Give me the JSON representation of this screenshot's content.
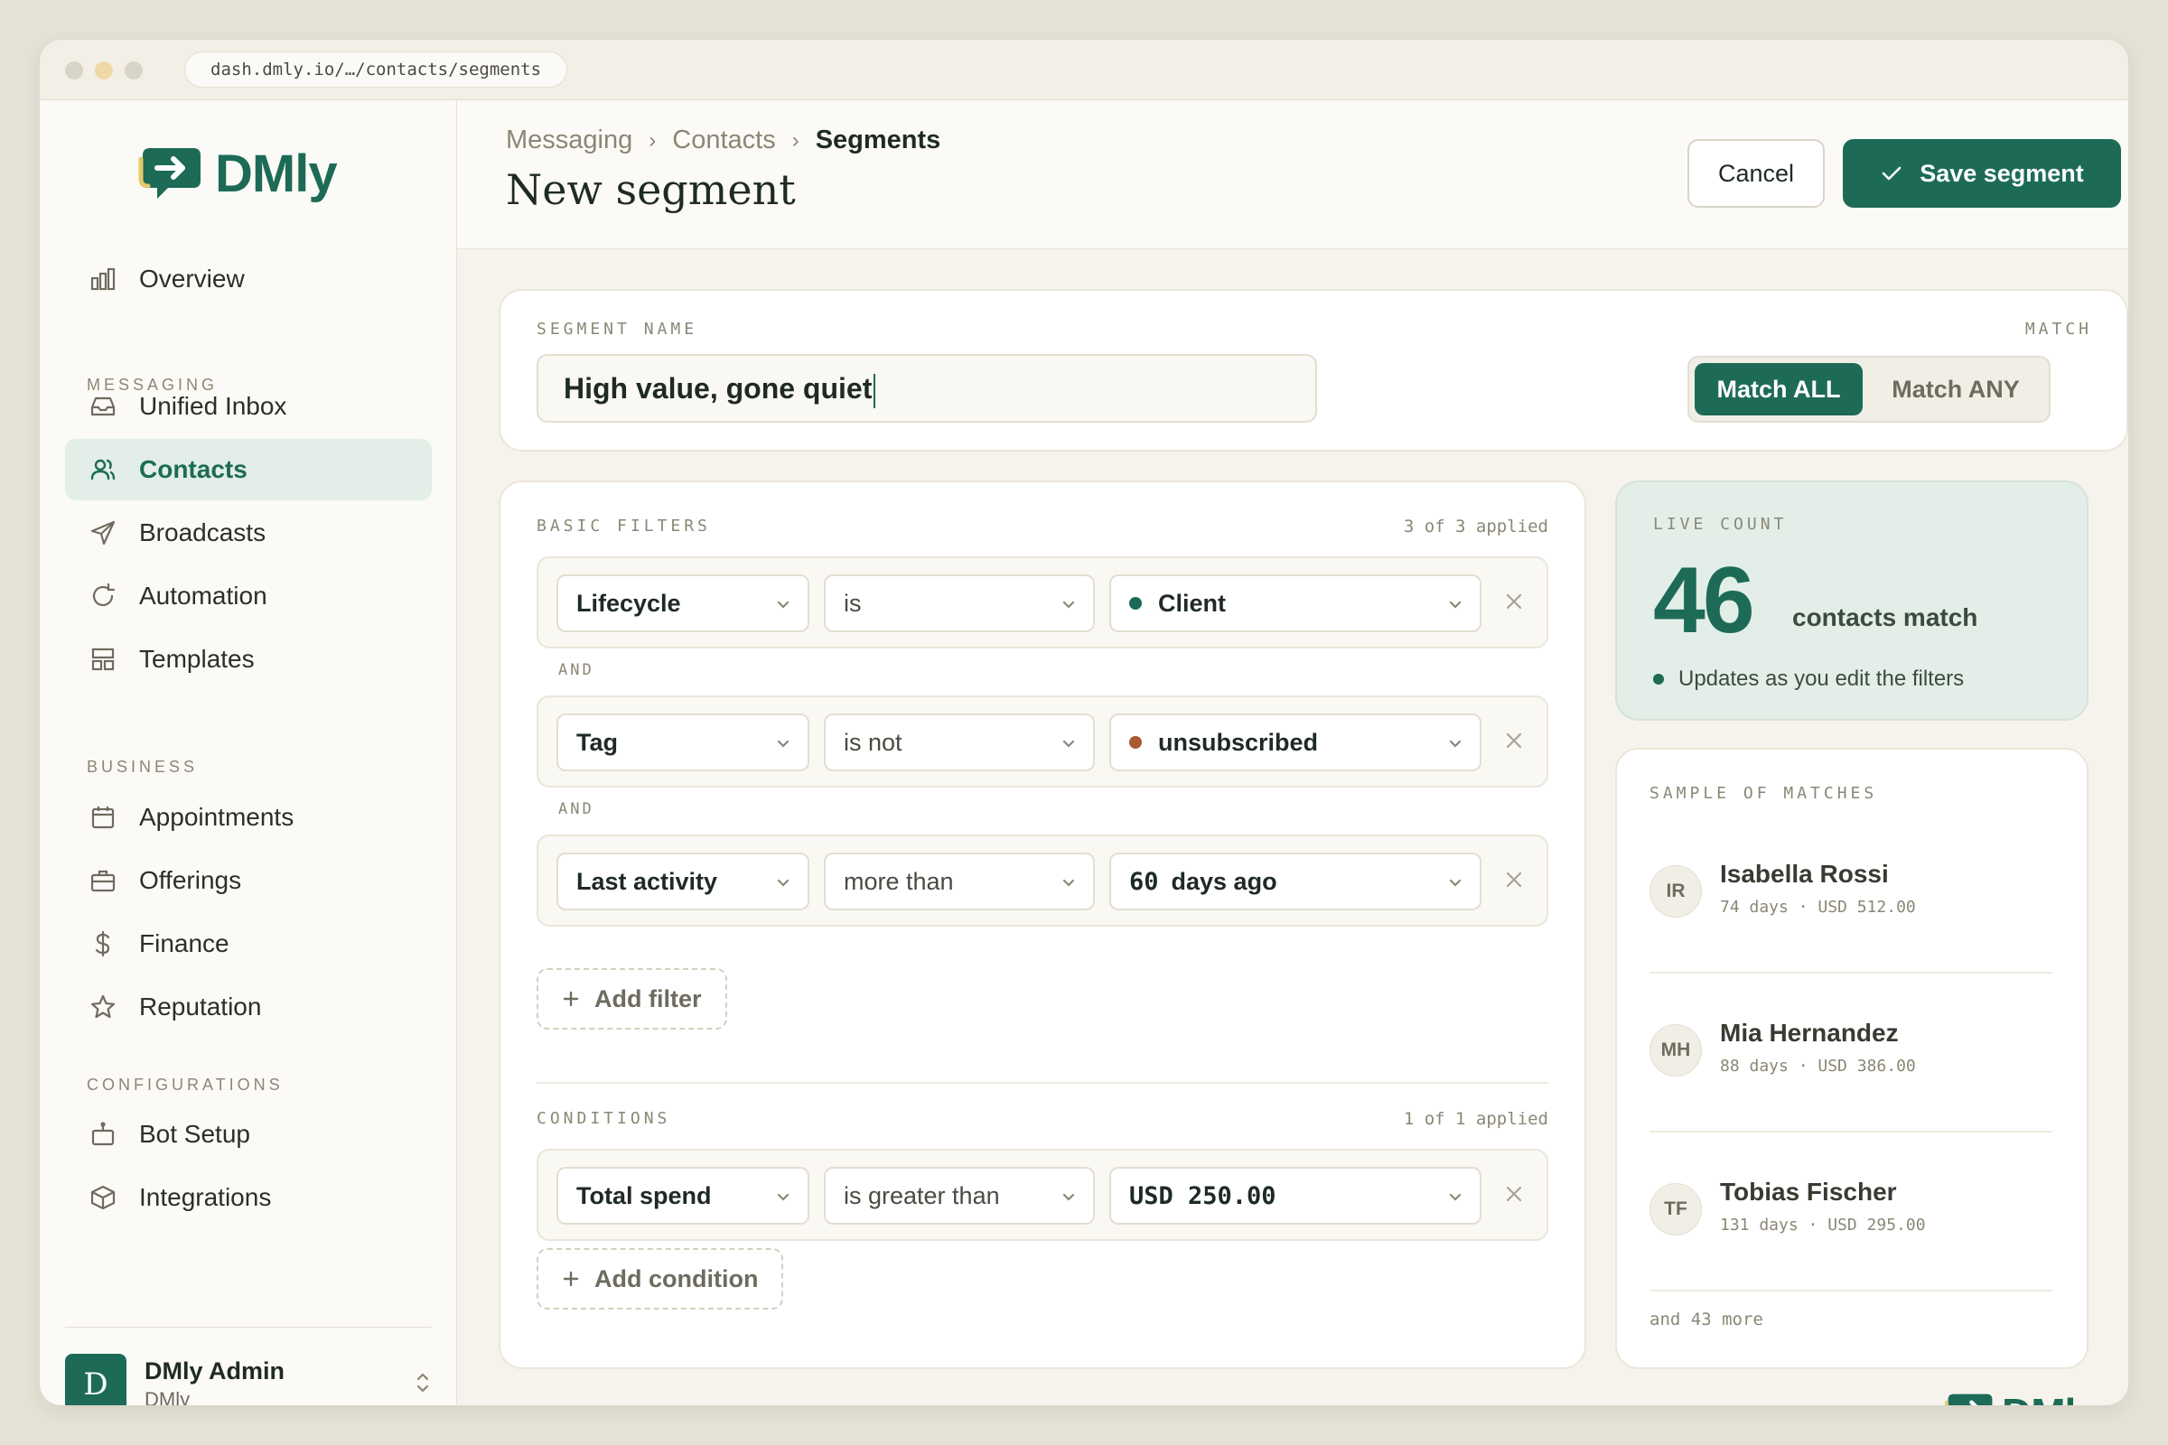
{
  "window": {
    "url": "dash.dmly.io/…/contacts/segments"
  },
  "brand": {
    "name": "DMly",
    "accent": "#1d6b57"
  },
  "sidebar": {
    "overview": {
      "label": "Overview",
      "icon": "bar-chart-icon"
    },
    "sections": [
      {
        "title": "MESSAGING",
        "items": [
          {
            "label": "Unified Inbox",
            "icon": "inbox-icon"
          },
          {
            "label": "Contacts",
            "icon": "users-icon",
            "active": true
          },
          {
            "label": "Broadcasts",
            "icon": "send-icon"
          },
          {
            "label": "Automation",
            "icon": "refresh-icon"
          },
          {
            "label": "Templates",
            "icon": "layout-icon"
          }
        ]
      },
      {
        "title": "BUSINESS",
        "items": [
          {
            "label": "Appointments",
            "icon": "calendar-icon"
          },
          {
            "label": "Offerings",
            "icon": "briefcase-icon"
          },
          {
            "label": "Finance",
            "icon": "dollar-icon"
          },
          {
            "label": "Reputation",
            "icon": "star-icon"
          }
        ]
      },
      {
        "title": "CONFIGURATIONS",
        "items": [
          {
            "label": "Bot Setup",
            "icon": "bot-icon"
          },
          {
            "label": "Integrations",
            "icon": "box-icon"
          }
        ]
      }
    ],
    "user": {
      "initial": "D",
      "name": "DMly Admin",
      "org": "DMly"
    }
  },
  "header": {
    "breadcrumbs": [
      "Messaging",
      "Contacts",
      "Segments"
    ],
    "title": "New segment",
    "cancel_label": "Cancel",
    "save_label": "Save segment"
  },
  "segment": {
    "name_label": "SEGMENT NAME",
    "name_value": "High value, gone quiet",
    "match_label": "MATCH",
    "match_options": [
      "Match ALL",
      "Match ANY"
    ],
    "match_selected": "Match ALL"
  },
  "filters": {
    "label": "BASIC FILTERS",
    "applied": "3 of 3 applied",
    "joiner": "AND",
    "rows": [
      {
        "field": "Lifecycle",
        "operator": "is",
        "value": "Client",
        "dot_color": "#1d6b57"
      },
      {
        "field": "Tag",
        "operator": "is not",
        "value": "unsubscribed",
        "dot_color": "#a85a32"
      },
      {
        "field": "Last activity",
        "operator": "more than",
        "value_num": "60",
        "value_unit": "days ago"
      }
    ],
    "add_label": "Add filter"
  },
  "conditions": {
    "label": "CONDITIONS",
    "applied": "1 of 1 applied",
    "rows": [
      {
        "field": "Total spend",
        "operator": "is greater than",
        "value": "USD 250.00"
      }
    ],
    "add_label": "Add condition"
  },
  "live_count": {
    "label": "LIVE COUNT",
    "count": "46",
    "suffix": "contacts match",
    "note": "Updates as you edit the filters"
  },
  "sample": {
    "label": "SAMPLE OF MATCHES",
    "people": [
      {
        "initials": "IR",
        "name": "Isabella Rossi",
        "meta": "74 days · USD 512.00"
      },
      {
        "initials": "MH",
        "name": "Mia Hernandez",
        "meta": "88 days · USD 386.00"
      },
      {
        "initials": "TF",
        "name": "Tobias Fischer",
        "meta": "131 days · USD 295.00"
      }
    ],
    "more": "and 43 more"
  }
}
